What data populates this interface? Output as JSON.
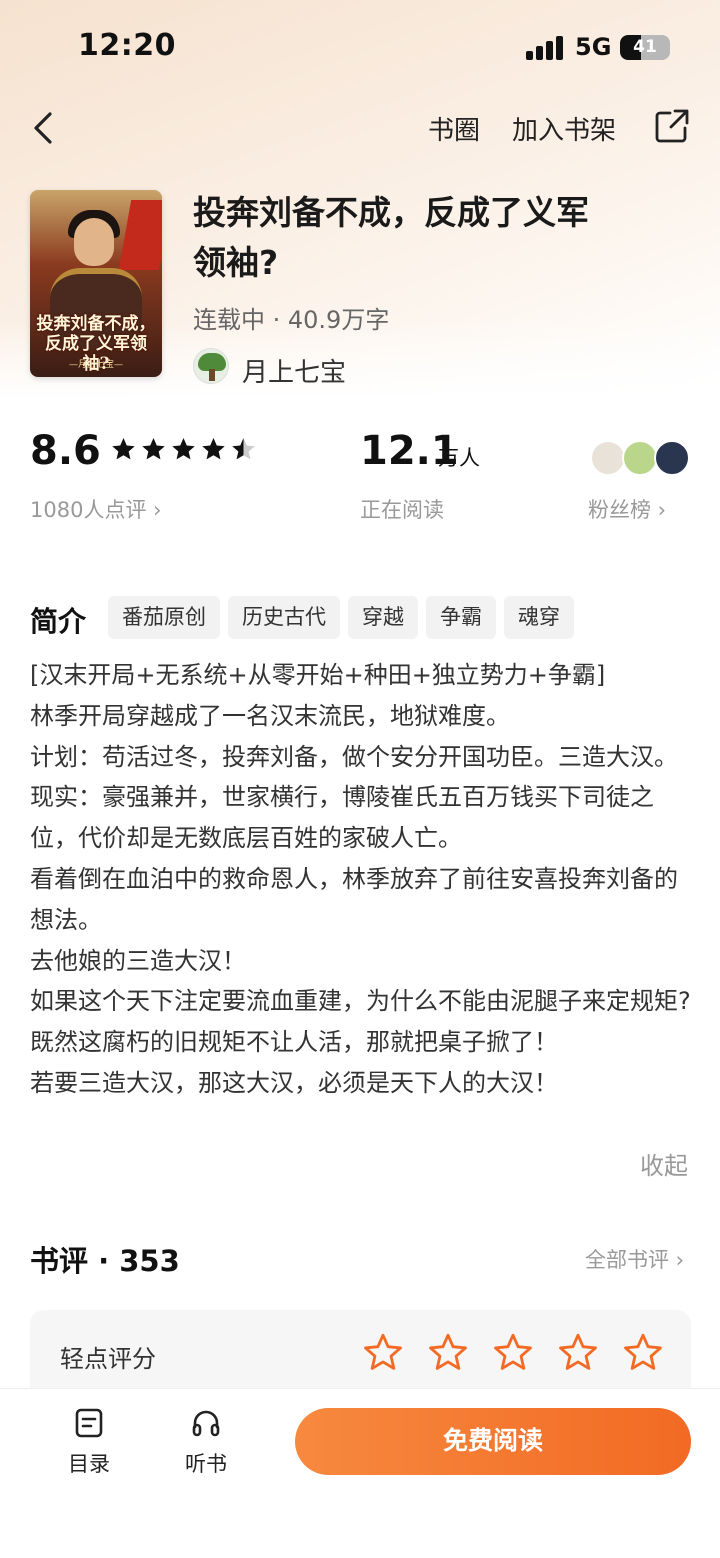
{
  "status_bar": {
    "time": "12:20",
    "network": "5G",
    "battery": "41",
    "battery_level": 0.41
  },
  "nav": {
    "back_icon": "chevron-left-icon",
    "circle_label": "书圈",
    "add_shelf_label": "加入书架",
    "share_icon": "share-icon"
  },
  "book": {
    "cover_title": "投奔刘备不成，反成了义军领袖?",
    "cover_author": "—月上七宝—",
    "title": "投奔刘备不成，反成了义军领袖?",
    "meta": "连载中 · 40.9万字",
    "author": "月上七宝"
  },
  "stats": {
    "rating": "8.6",
    "stars_value": 4.5,
    "rating_count_label": "1080人点评 ›",
    "readers": "12.1",
    "readers_unit": "万人",
    "readers_label": "正在阅读",
    "fans_label": "粉丝榜 ›"
  },
  "intro": {
    "title": "简介",
    "tags": [
      "番茄原创",
      "历史古代",
      "穿越",
      "争霸",
      "魂穿"
    ],
    "paragraphs": [
      "[汉末开局+无系统+从零开始+种田+独立势力+争霸]",
      "林季开局穿越成了一名汉末流民，地狱难度。",
      "计划：苟活过冬，投奔刘备，做个安分开国功臣。三造大汉。",
      "现实：豪强兼并，世家横行，博陵崔氏五百万钱买下司徒之位，代价却是无数底层百姓的家破人亡。",
      "看着倒在血泊中的救命恩人，林季放弃了前往安喜投奔刘备的想法。",
      "去他娘的三造大汉！",
      "如果这个天下注定要流血重建，为什么不能由泥腿子来定规矩?",
      "既然这腐朽的旧规矩不让人活，那就把桌子掀了！",
      "若要三造大汉，那这大汉，必须是天下人的大汉！"
    ],
    "collapse_label": "收起"
  },
  "reviews": {
    "title": "书评 · 353",
    "all_label": "全部书评 ›",
    "rate_label": "轻点评分",
    "rate_star_count": 5
  },
  "bottom": {
    "toc_label": "目录",
    "listen_label": "听书",
    "read_button": "免费阅读"
  },
  "colors": {
    "accent": "#f26a24",
    "star_outline": "#f26a24",
    "star_fill": "#111111"
  }
}
